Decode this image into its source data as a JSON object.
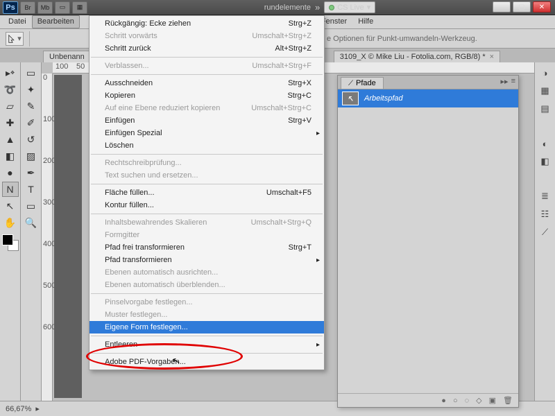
{
  "titlebar": {
    "br": "Br",
    "mb": "Mb",
    "center_text": "rundelemente",
    "cslive": "CS Live"
  },
  "menubar": {
    "datei": "Datei",
    "bearbeiten": "Bearbeiten",
    "fenster": "Fenster",
    "hilfe": "Hilfe"
  },
  "optionsbar": {
    "hint": "e Optionen für Punkt-umwandeln-Werkzeug."
  },
  "doctabs": {
    "left": "Unbenann",
    "right": "3109_X  © Mike Liu - Fotolia.com, RGB/8) *"
  },
  "ruler_h": [
    "100",
    "50"
  ],
  "ruler_v": [
    "0",
    "",
    "100",
    "",
    "200",
    "",
    "300",
    "",
    "400",
    "",
    "500",
    "",
    "600",
    ""
  ],
  "dropdown": {
    "undo": "Rückgängig: Ecke ziehen",
    "undo_sc": "Strg+Z",
    "step_fwd": "Schritt vorwärts",
    "step_fwd_sc": "Umschalt+Strg+Z",
    "step_back": "Schritt zurück",
    "step_back_sc": "Alt+Strg+Z",
    "fade": "Verblassen...",
    "fade_sc": "Umschalt+Strg+F",
    "cut": "Ausschneiden",
    "cut_sc": "Strg+X",
    "copy": "Kopieren",
    "copy_sc": "Strg+C",
    "copy_merged": "Auf eine Ebene reduziert kopieren",
    "copy_merged_sc": "Umschalt+Strg+C",
    "paste": "Einfügen",
    "paste_sc": "Strg+V",
    "paste_special": "Einfügen Spezial",
    "delete": "Löschen",
    "spell": "Rechtschreibprüfung...",
    "findreplace": "Text suchen und ersetzen...",
    "fill": "Fläche füllen...",
    "fill_sc": "Umschalt+F5",
    "stroke": "Kontur füllen...",
    "content_scale": "Inhaltsbewahrendes Skalieren",
    "content_scale_sc": "Umschalt+Strg+Q",
    "puppet": "Formgitter",
    "free_transform": "Pfad frei transformieren",
    "free_transform_sc": "Strg+T",
    "transform": "Pfad transformieren",
    "auto_align": "Ebenen automatisch ausrichten...",
    "auto_blend": "Ebenen automatisch überblenden...",
    "define_brush": "Pinselvorgabe festlegen...",
    "define_pattern": "Muster festlegen...",
    "define_shape": "Eigene Form festlegen...",
    "purge": "Entleeren",
    "pdf_presets": "Adobe PDF-Vorgaben..."
  },
  "paths_panel": {
    "tab": "Pfade",
    "workpath": "Arbeitspfad"
  },
  "status": {
    "zoom": "66,67%"
  }
}
